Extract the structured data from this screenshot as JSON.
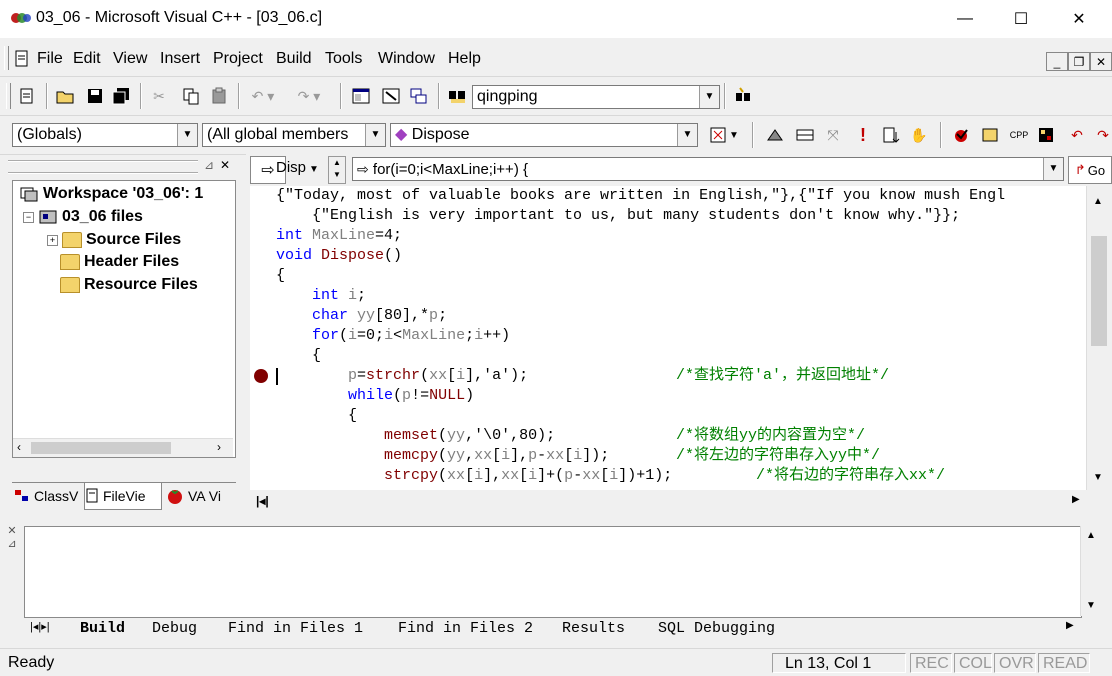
{
  "window": {
    "title": "03_06 - Microsoft Visual C++ - [03_06.c]",
    "minimize": "—",
    "maximize": "☐",
    "close": "✕"
  },
  "menu": [
    "File",
    "Edit",
    "View",
    "Insert",
    "Project",
    "Build",
    "Tools",
    "Window",
    "Help"
  ],
  "toolbar": {
    "find_combo": "qingping"
  },
  "wizardbar": {
    "class_combo": "(Globals)",
    "members_combo": "(All global members",
    "function_combo": "Dispose"
  },
  "workspace": {
    "tree": [
      {
        "label": "Workspace '03_06': 1"
      },
      {
        "label": "03_06 files"
      },
      {
        "label": "Source Files"
      },
      {
        "label": "Header Files"
      },
      {
        "label": "Resource Files"
      }
    ],
    "tabs": [
      "ClassV",
      "FileVie",
      "VA Vi"
    ]
  },
  "editor": {
    "nav_left": "Disp",
    "nav_right": "for(i=0;i<MaxLine;i++) {",
    "go_button": "Go"
  },
  "output": {
    "tabs": [
      "Build",
      "Debug",
      "Find in Files 1",
      "Find in Files 2",
      "Results",
      "SQL Debugging"
    ]
  },
  "status": {
    "ready": "Ready",
    "position": "Ln 13, Col 1",
    "rec": "REC",
    "col": "COL",
    "ovr": "OVR",
    "read": "READ"
  },
  "code": {
    "l1": "{\"Today, most of valuable books are written in English,\"},{\"If you know mush Engl",
    "l2": "    {\"English is very important to us, but many students don't know why.\"}};",
    "l3_kw": "int",
    "l3_var": " MaxLine",
    "l3_rest": "=4;",
    "l4_kw": "void",
    "l4_fn": " Dispose",
    "l4_rest": "()",
    "l5": "{",
    "l6_kw": "    int",
    "l6_var": " i",
    "l6_rest": ";",
    "l7_kw": "    char",
    "l7_var": " yy",
    "l7_rest": "[80],*",
    "l7_var2": "p",
    "l7_rest2": ";",
    "l8_kw": "    for",
    "l8_a": "(",
    "l8_b": "i",
    "l8_c": "=0;",
    "l8_d": "i",
    "l8_e": "<",
    "l8_f": "MaxLine",
    "l8_g": ";",
    "l8_h": "i",
    "l8_i": "++)",
    "l9": "    {",
    "l10_a": "        ",
    "l10_var": "p",
    "l10_b": "=",
    "l10_fn": "strchr",
    "l10_c": "(",
    "l10_d": "xx",
    "l10_e": "[",
    "l10_f": "i",
    "l10_g": "],'a');",
    "l10_cm": "/*查找字符'a'，并返回地址*/",
    "l11_kw": "        while",
    "l11_a": "(",
    "l11_b": "p",
    "l11_c": "!=",
    "l11_d": "NULL",
    "l11_e": ")",
    "l12": "        {",
    "l13_fn": "            memset",
    "l13_a": "(",
    "l13_b": "yy",
    "l13_c": ",'\\0',80);",
    "l13_cm": "/*将数组yy的内容置为空*/",
    "l14_fn": "            memcpy",
    "l14_a": "(",
    "l14_b": "yy",
    "l14_c": ",",
    "l14_d": "xx",
    "l14_e": "[",
    "l14_f": "i",
    "l14_g": "],",
    "l14_h": "p",
    "l14_i": "-",
    "l14_j": "xx",
    "l14_k": "[",
    "l14_l": "i",
    "l14_m": "]);",
    "l14_cm": "/*将左边的字符串存入yy中*/",
    "l15_fn": "            strcpy",
    "l15_a": "(",
    "l15_b": "xx",
    "l15_c": "[",
    "l15_d": "i",
    "l15_e": "],",
    "l15_f": "xx",
    "l15_g": "[",
    "l15_h": "i",
    "l15_i": "]+(",
    "l15_j": "p",
    "l15_k": "-",
    "l15_l": "xx",
    "l15_m": "[",
    "l15_n": "i",
    "l15_o": "])+1);",
    "l15_cm": "/*将右边的字符串存入xx*/"
  }
}
